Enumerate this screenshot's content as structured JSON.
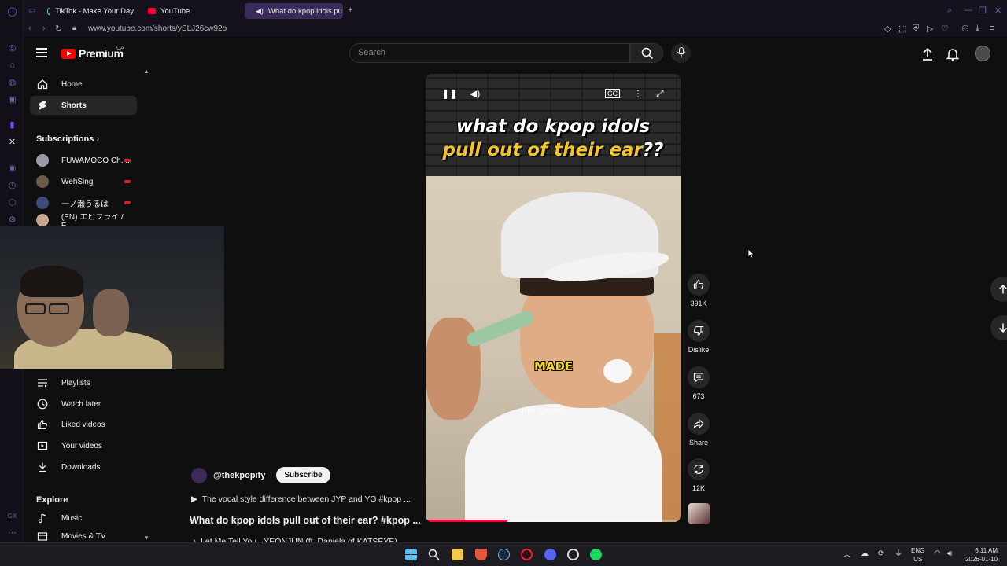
{
  "browser": {
    "tabs": [
      {
        "label": "TikTok - Make Your Day"
      },
      {
        "label": "YouTube"
      },
      {
        "label": "What do kpop idols pu"
      }
    ],
    "url": "www.youtube.com/shorts/ySLJ26cw92o"
  },
  "header": {
    "logo_text": "Premium",
    "region": "CA",
    "search_placeholder": "Search"
  },
  "sidebar": {
    "items": [
      {
        "label": "Home"
      },
      {
        "label": "Shorts"
      }
    ],
    "subscriptions_title": "Subscriptions",
    "subscriptions": [
      {
        "label": "FUWAMOCO Ch. ..."
      },
      {
        "label": "WehSing"
      },
      {
        "label": "一ノ瀬うるは"
      },
      {
        "label": "(EN) エビフライ / E..."
      }
    ],
    "you_items": [
      {
        "label": "Playlists"
      },
      {
        "label": "Watch later"
      },
      {
        "label": "Liked videos"
      },
      {
        "label": "Your videos"
      },
      {
        "label": "Downloads"
      }
    ],
    "explore_title": "Explore",
    "explore_items": [
      {
        "label": "Music"
      },
      {
        "label": "Movies & TV"
      }
    ]
  },
  "short": {
    "headline_line1": "what do kpop idols",
    "headline_line2": "pull out of their ear",
    "headline_q": "??",
    "caption": "MADE",
    "watermark": "the.kpopify",
    "progress": 0.32
  },
  "actions": {
    "likes": "391K",
    "dislike": "Dislike",
    "comments": "673",
    "share": "Share",
    "remix": "12K"
  },
  "meta": {
    "channel": "@thekpopify",
    "subscribe": "Subscribe",
    "related": "The vocal style difference between JYP and YG #kpop ...",
    "title": "What do kpop idols pull out of their ear? #kpop ...",
    "song": "Let Me Tell You · YEONJUN (ft. Daniela of KATSEYE)"
  },
  "taskbar": {
    "lang1": "ENG",
    "lang2": "US",
    "time": "6:11 AM",
    "date": "2026-01-10"
  },
  "colors": {
    "accent": "#ff0033",
    "brand_tab": "#3a2b5a",
    "headline_yellow": "#f5c525"
  }
}
